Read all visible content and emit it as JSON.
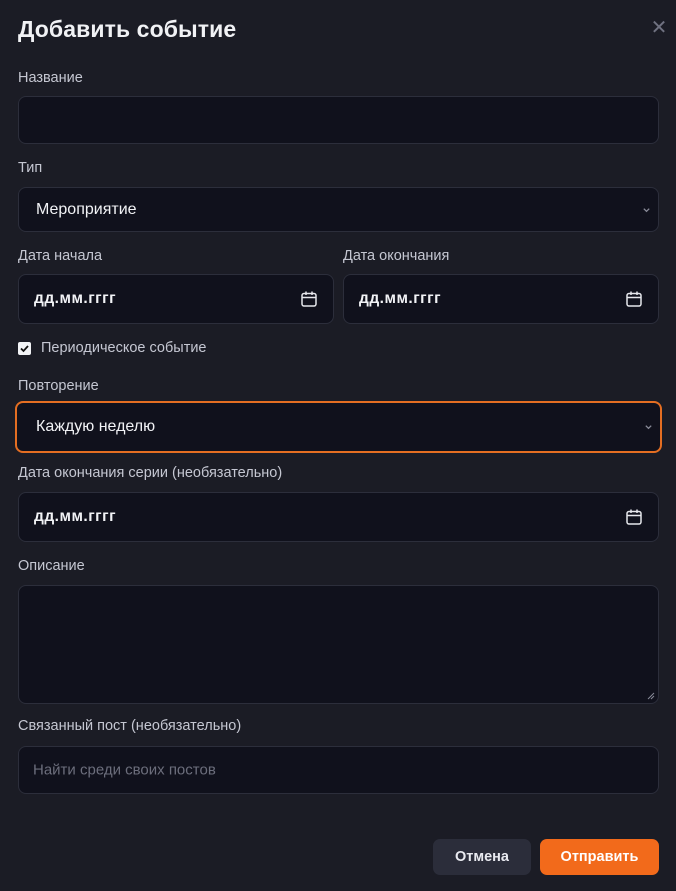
{
  "dialog": {
    "title": "Добавить событие",
    "close_symbol": "✕",
    "close_icon": "close-icon"
  },
  "fields": {
    "name": {
      "label": "Название",
      "value": ""
    },
    "type": {
      "label": "Тип",
      "value": "Мероприятие"
    },
    "start_date": {
      "label": "Дата начала",
      "value": "дд.мм.гггг"
    },
    "end_date": {
      "label": "Дата окончания",
      "value": "дд.мм.гггг"
    },
    "recurring": {
      "label": "Периодическое событие",
      "checked": true
    },
    "repeat": {
      "label": "Повторение",
      "value": "Каждую неделю"
    },
    "series_end": {
      "label": "Дата окончания серии (необязательно)",
      "value": "дд.мм.гггг"
    },
    "description": {
      "label": "Описание",
      "value": ""
    },
    "linked_post": {
      "label": "Связанный пост (необязательно)",
      "placeholder": "Найти среди своих постов"
    }
  },
  "buttons": {
    "cancel": "Отмена",
    "submit": "Отправить"
  },
  "colors": {
    "background": "#1b1c25",
    "field": "#10111c",
    "accent": "#f26a1b",
    "focus_border": "#e46e22"
  }
}
